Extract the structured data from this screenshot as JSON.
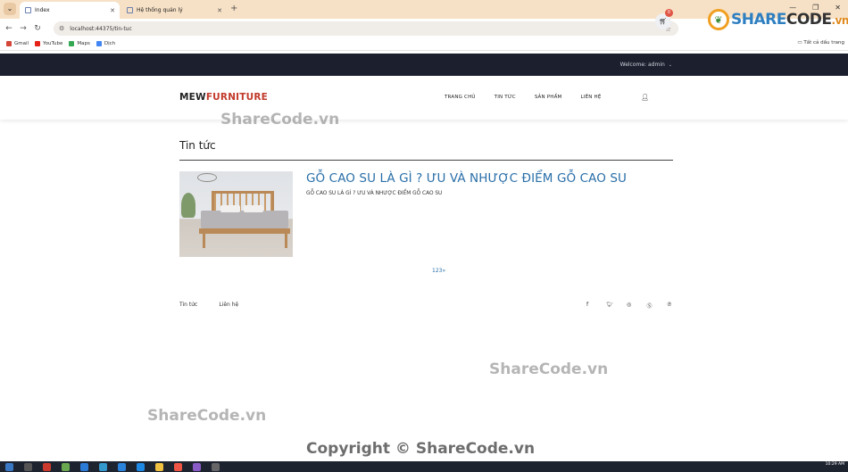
{
  "browser": {
    "tabs": [
      {
        "label": "Index",
        "active": true
      },
      {
        "label": "Hệ thống quản lý",
        "active": false
      }
    ],
    "url": "localhost:44375/tin-tuc",
    "bookmarks": [
      "Gmail",
      "YouTube",
      "Maps",
      "Dịch"
    ],
    "bookmarks_right": "Tất cả dấu trang"
  },
  "watermark": {
    "logo_a": "SHARE",
    "logo_b": "CODE",
    "logo_c": ".vn",
    "mid": "ShareCode.vn",
    "copyright": "Copyright © ShareCode.vn"
  },
  "topbar": {
    "welcome": "Welcome: admin"
  },
  "header": {
    "brand_1": "MEW",
    "brand_2": "FURNITURE",
    "menu": [
      "TRANG CHỦ",
      "TIN TỨC",
      "SẢN PHẨM",
      "LIÊN HỆ"
    ],
    "cart_count": "0"
  },
  "main": {
    "page_title": "Tin tức",
    "post": {
      "title": "GỖ CAO SU LÀ GÌ ? ƯU VÀ NHƯỢC ĐIỂM GỖ CAO SU",
      "excerpt": "GỖ CAO SU LÀ GÌ ? ƯU VÀ NHƯỢC ĐIỂM GỖ CAO SU"
    },
    "pager": "123»"
  },
  "footer": {
    "links": [
      "Tin tức",
      "Liên hệ"
    ],
    "social_icons": [
      "facebook-icon",
      "twitter-icon",
      "instagram-icon",
      "skype-icon",
      "pinterest-icon"
    ]
  },
  "taskbar": {
    "time": "10:29 AM"
  },
  "colors": {
    "topbar": "#1b1f2e",
    "brand_accent": "#c23a2b",
    "link": "#2a6fa8"
  }
}
